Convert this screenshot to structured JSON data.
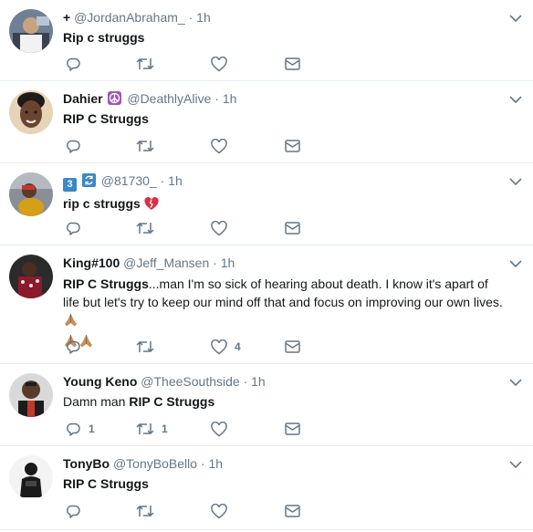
{
  "tweets": [
    {
      "prefix": "+",
      "name": "",
      "handle": "@JordanAbraham_",
      "dot": "·",
      "time": "1h",
      "text_bold": "Rip c struggs",
      "text_rest": "",
      "reply_count": "",
      "retweet_count": "",
      "like_count": ""
    },
    {
      "prefix": "",
      "name": "Dahier",
      "handle": "@DeathlyAlive",
      "dot": "·",
      "time": "1h",
      "text_bold": "RIP C Struggs",
      "text_rest": "",
      "reply_count": "",
      "retweet_count": "",
      "like_count": ""
    },
    {
      "prefix": "",
      "name": "",
      "badge_number": "3",
      "handle": "@81730_",
      "dot": "·",
      "time": "1h",
      "text_bold": "rip c struggs",
      "text_rest": "",
      "reply_count": "",
      "retweet_count": "",
      "like_count": ""
    },
    {
      "prefix": "",
      "name": "King#100",
      "handle": "@Jeff_Mansen",
      "dot": "·",
      "time": "1h",
      "text_bold": "RIP C Struggs",
      "text_rest": "...man I'm so sick of hearing about death. I know it's apart of life but let's try to keep our mind off that and focus on improving our own lives.",
      "reply_count": "",
      "retweet_count": "",
      "like_count": "4"
    },
    {
      "prefix": "",
      "name": "Young Keno",
      "handle": "@TheeSouthside",
      "dot": "·",
      "time": "1h",
      "text_pre": "Damn man ",
      "text_bold": "RIP C Struggs",
      "text_rest": "",
      "reply_count": "1",
      "retweet_count": "1",
      "like_count": ""
    },
    {
      "prefix": "",
      "name": "TonyBo",
      "handle": "@TonyBoBello",
      "dot": "·",
      "time": "1h",
      "text_bold": "RIP C Struggs",
      "text_rest": "",
      "reply_count": "",
      "retweet_count": "",
      "like_count": ""
    }
  ],
  "colors": {
    "text": "#14171a",
    "muted": "#657786",
    "icon": "#657786",
    "divider": "#e6ecf0",
    "badge_blue": "#3b88c3",
    "peace_purple": "#9b59b6",
    "heart_broken": "#dd2e44"
  },
  "icons": {
    "reply": "reply-icon",
    "retweet": "retweet-icon",
    "like": "heart-icon",
    "dm": "envelope-icon",
    "menu": "chevron-down-icon"
  }
}
